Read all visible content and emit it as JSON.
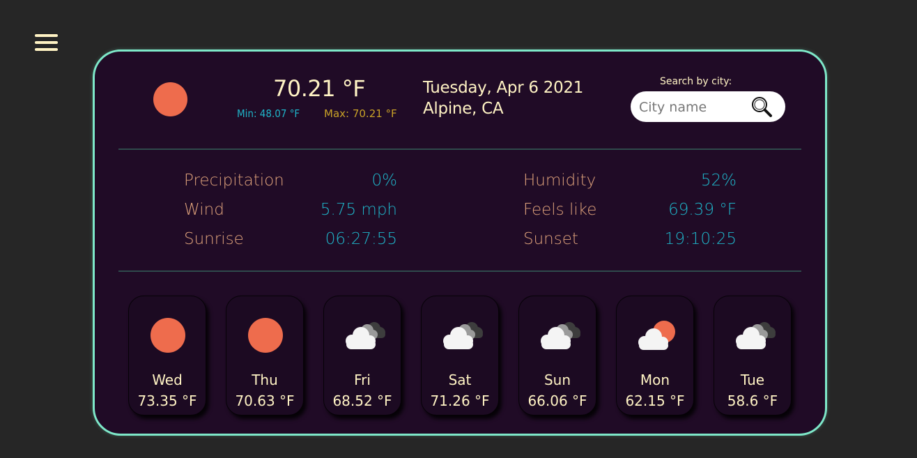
{
  "menu": {
    "icon": "hamburger-menu-icon"
  },
  "current": {
    "icon": "sun-icon",
    "temperature": "70.21 °F",
    "min": "Min: 48.07 °F",
    "max": "Max: 70.21 °F",
    "date": "Tuesday, Apr 6 2021",
    "location": "Alpine, CA"
  },
  "search": {
    "label": "Search by city:",
    "placeholder": "City name",
    "value": "",
    "icon": "magnifier-icon"
  },
  "stats": [
    {
      "label": "Precipitation",
      "value": "0%"
    },
    {
      "label": "Humidity",
      "value": "52%"
    },
    {
      "label": "Wind",
      "value": "5.75 mph"
    },
    {
      "label": "Feels like",
      "value": "69.39 °F"
    },
    {
      "label": "Sunrise",
      "value": "06:27:55"
    },
    {
      "label": "Sunset",
      "value": "19:10:25"
    }
  ],
  "forecast": [
    {
      "day": "Wed",
      "temp": "73.35 °F",
      "icon": "sun-icon"
    },
    {
      "day": "Thu",
      "temp": "70.63 °F",
      "icon": "sun-icon"
    },
    {
      "day": "Fri",
      "temp": "68.52 °F",
      "icon": "clouds-icon"
    },
    {
      "day": "Sat",
      "temp": "71.26 °F",
      "icon": "clouds-icon"
    },
    {
      "day": "Sun",
      "temp": "66.06 °F",
      "icon": "clouds-icon"
    },
    {
      "day": "Mon",
      "temp": "62.15 °F",
      "icon": "partly-cloudy-icon"
    },
    {
      "day": "Tue",
      "temp": "58.6 °F",
      "icon": "clouds-icon"
    }
  ],
  "colors": {
    "page_background": "#262626",
    "card_background": "#200b26",
    "card_border": "#7ee8c9",
    "primary_text": "#fff3c4",
    "label_text": "#e0a37c",
    "value_text": "#1fb5c9",
    "max_text": "#c9a227",
    "sun": "#ee6c4d"
  }
}
